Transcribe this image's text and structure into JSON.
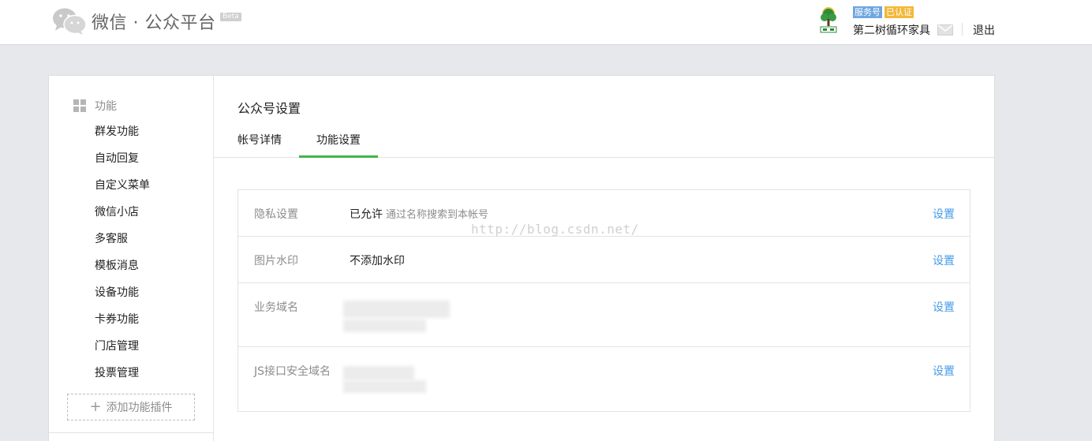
{
  "header": {
    "brand": "微信 · 公众平台",
    "beta": "Beta",
    "tags": [
      "服务号",
      "已认证"
    ],
    "account_name": "第二树循环家具",
    "logout": "退出"
  },
  "sidebar": {
    "section_label": "功能",
    "items": [
      "群发功能",
      "自动回复",
      "自定义菜单",
      "微信小店",
      "多客服",
      "模板消息",
      "设备功能",
      "卡券功能",
      "门店管理",
      "投票管理"
    ],
    "add_plugin": "添加功能插件"
  },
  "main": {
    "title": "公众号设置",
    "tabs": [
      "帐号详情",
      "功能设置"
    ],
    "active_tab": "功能设置",
    "settings": [
      {
        "label": "隐私设置",
        "value": "已允许",
        "desc": "通过名称搜索到本帐号",
        "action": "设置"
      },
      {
        "label": "图片水印",
        "value": "不添加水印",
        "desc": "",
        "action": "设置"
      },
      {
        "label": "业务域名",
        "value": "",
        "desc": "",
        "action": "设置"
      },
      {
        "label": "JS接口安全域名",
        "value": "",
        "desc": "",
        "action": "设置"
      }
    ]
  },
  "watermark": "http://blog.csdn.net/",
  "colors": {
    "accent_green": "#44b549",
    "link_blue": "#459ae9",
    "tag_blue": "#6ea6e0",
    "tag_orange": "#f4b73a",
    "page_bg": "#e7e8eb"
  },
  "icons": [
    "wechat-logo-icon",
    "tree-avatar-icon",
    "mail-icon",
    "grid-icon",
    "plus-icon"
  ]
}
